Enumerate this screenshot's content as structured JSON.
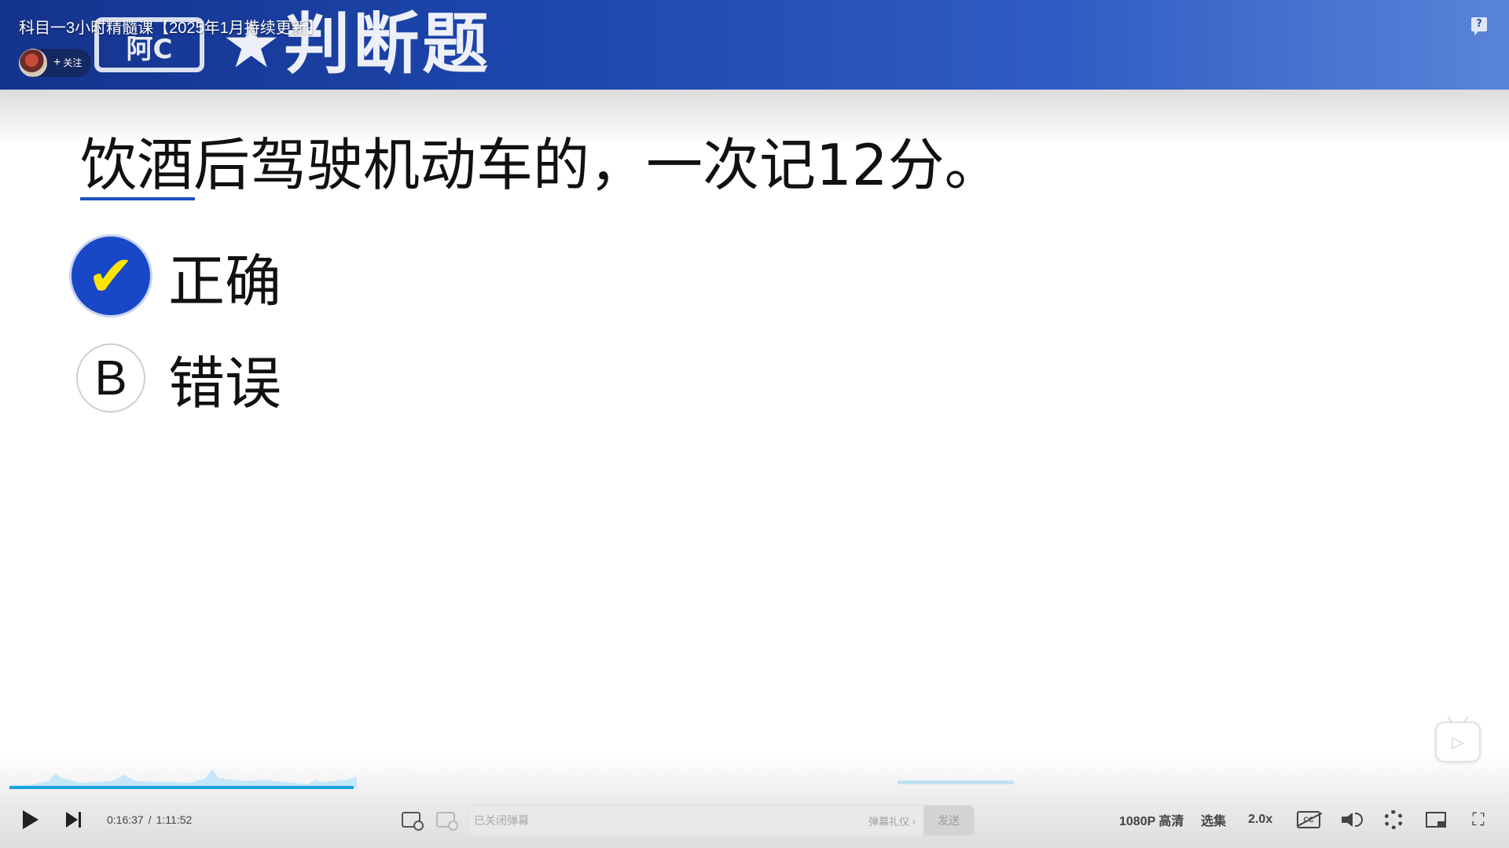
{
  "banner": {
    "video_title": "科目一3小时精髓课【2025年1月持续更新】",
    "heading": "★判断题",
    "chip_text": "阿C",
    "follow_label": "关注"
  },
  "slide": {
    "question": "饮酒后驾驶机动车的，一次记12分。",
    "options": [
      {
        "marker": "✔",
        "label": "正确",
        "state": "correct"
      },
      {
        "marker": "B",
        "label": "错误",
        "state": "default"
      }
    ],
    "accent_color": "#1848c8",
    "check_color": "#ffe600"
  },
  "player": {
    "current_time": "0:16:37",
    "time_separator": "/",
    "total_time": "1:11:52",
    "progress_fraction": 0.231,
    "danmaku_placeholder": "已关闭弹幕",
    "danmaku_etiquette": "弹幕礼仪 ›",
    "send_label": "发送",
    "quality": "1080P 高清",
    "episodes": "选集",
    "speed": "2.0x",
    "progress_color": "#1aa1e0",
    "fullscreen_glyph": "⛶",
    "tv_glyph": "▷"
  },
  "icons": {
    "help": "help-icon",
    "play": "play-icon",
    "next": "next-icon",
    "danmaku_toggle": "danmaku-toggle-icon",
    "danmaku_settings": "danmaku-setting-icon",
    "subtitles_off": "subtitle-off-icon",
    "volume": "volume-icon",
    "settings": "gear-icon",
    "pip": "pip-icon",
    "fullscreen": "fullscreen-icon"
  }
}
